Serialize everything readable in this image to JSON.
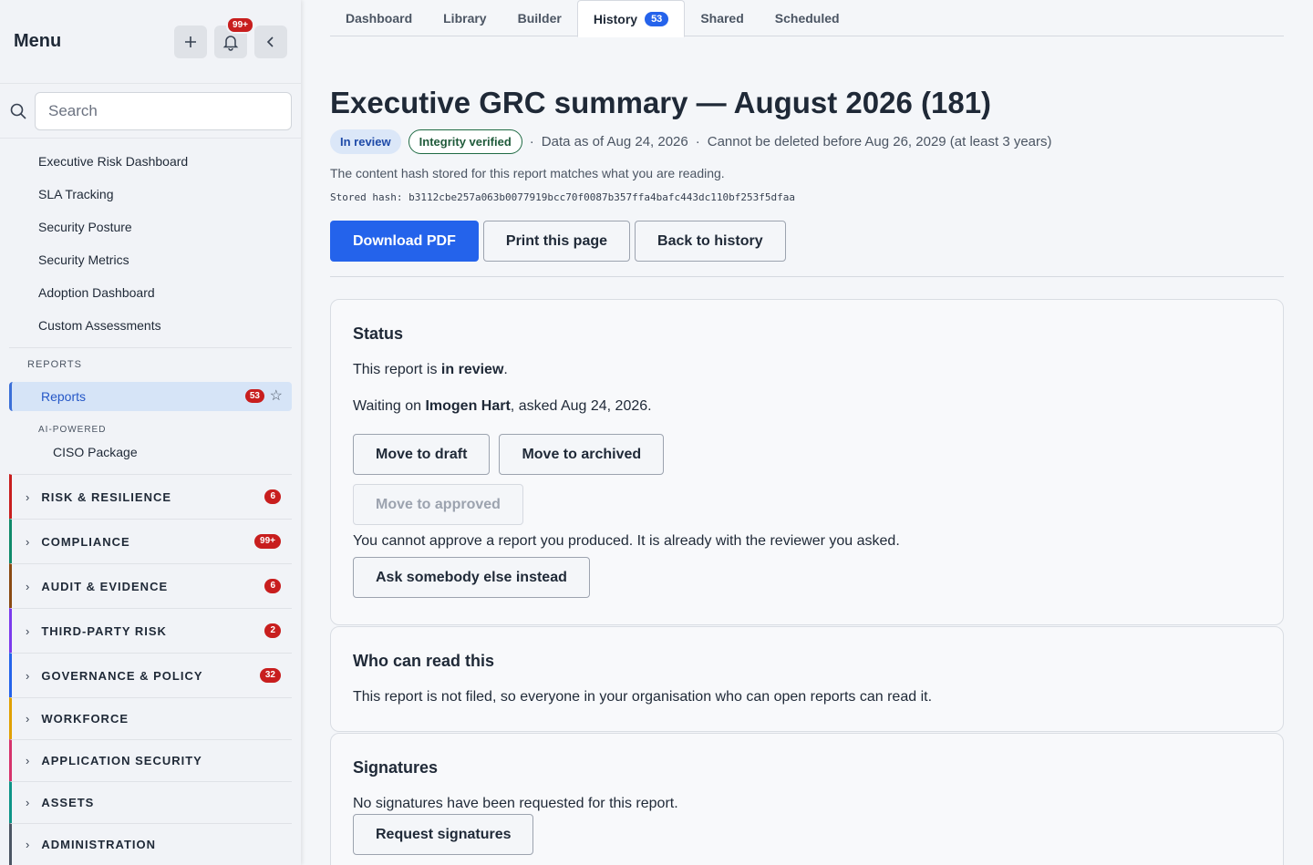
{
  "sidebar": {
    "title": "Menu",
    "notif_count": "99+",
    "search_placeholder": "Search",
    "dashboard_items": [
      "Executive Risk Dashboard",
      "SLA Tracking",
      "Security Posture",
      "Security Metrics",
      "Adoption Dashboard",
      "Custom Assessments"
    ],
    "reports_section": "REPORTS",
    "reports_item": "Reports",
    "reports_count": "53",
    "ai_label": "AI-POWERED",
    "ai_item": "CISO Package",
    "groups": [
      {
        "label": "RISK & RESILIENCE",
        "count": "6",
        "color": "#c81e1e"
      },
      {
        "label": "COMPLIANCE",
        "count": "99+",
        "color": "#0f8a6a"
      },
      {
        "label": "AUDIT & EVIDENCE",
        "count": "6",
        "color": "#8a4a12"
      },
      {
        "label": "THIRD-PARTY RISK",
        "count": "2",
        "color": "#7c3aed"
      },
      {
        "label": "GOVERNANCE & POLICY",
        "count": "32",
        "color": "#2563eb"
      },
      {
        "label": "WORKFORCE",
        "count": "",
        "color": "#e0a000"
      },
      {
        "label": "APPLICATION SECURITY",
        "count": "",
        "color": "#d6336c"
      },
      {
        "label": "ASSETS",
        "count": "",
        "color": "#0d9488"
      },
      {
        "label": "ADMINISTRATION",
        "count": "",
        "color": "#4b5563"
      }
    ]
  },
  "tabs": [
    {
      "label": "Dashboard"
    },
    {
      "label": "Library"
    },
    {
      "label": "Builder"
    },
    {
      "label": "History",
      "count": "53"
    },
    {
      "label": "Shared"
    },
    {
      "label": "Scheduled"
    }
  ],
  "report": {
    "title": "Executive GRC summary — August 2026 (181)",
    "status_pill": "In review",
    "integrity_pill": "Integrity verified",
    "sep": "·",
    "data_as_of": "Data as of Aug 24, 2026",
    "retention": "Cannot be deleted before Aug 26, 2029 (at least 3 years)",
    "hash_note": "The content hash stored for this report matches what you are reading.",
    "stored_hash": "Stored hash: b3112cbe257a063b0077919bcc70f0087b357ffa4bafc443dc110bf253f5dfaa",
    "download_label": "Download PDF",
    "print_label": "Print this page",
    "back_label": "Back to history"
  },
  "status_card": {
    "heading": "Status",
    "line1_prefix": "This report is ",
    "line1_bold": "in review",
    "line1_suffix": ".",
    "line2_prefix": "Waiting on ",
    "line2_bold": "Imogen Hart",
    "line2_suffix": ", asked Aug 24, 2026.",
    "move_draft": "Move to draft",
    "move_archived": "Move to archived",
    "move_approved": "Move to approved",
    "cannot_approve": "You cannot approve a report you produced. It is already with the reviewer you asked.",
    "ask_else": "Ask somebody else instead"
  },
  "read_card": {
    "heading": "Who can read this",
    "text": "This report is not filed, so everyone in your organisation who can open reports can read it."
  },
  "sig_card": {
    "heading": "Signatures",
    "text": "No signatures have been requested for this report.",
    "button": "Request signatures"
  }
}
